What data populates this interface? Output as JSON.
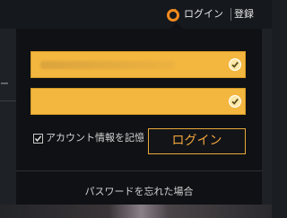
{
  "header": {
    "login_label": "ログイン",
    "register_label": "登録",
    "icon": "origin-icon"
  },
  "background": {
    "nav_text": "ー"
  },
  "login_form": {
    "email_field": {
      "value": "",
      "icon": "check-circle-icon"
    },
    "password_field": {
      "value": "",
      "icon": "check-circle-icon"
    },
    "remember_label": "アカウント情報を記憶",
    "remember_checked": true,
    "login_button_label": "ログイン",
    "forgot_password_label": "パスワードを忘れた場合"
  },
  "colors": {
    "accent": "#f3b63f",
    "button_text": "#f0a43c",
    "panel_bg": "#0f1114"
  }
}
